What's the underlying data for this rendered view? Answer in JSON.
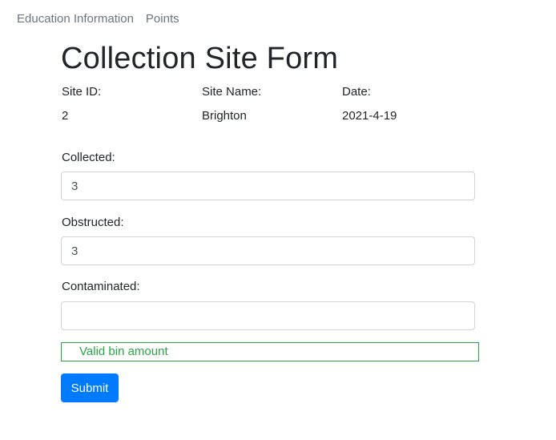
{
  "nav": {
    "items": [
      "Education Information",
      "Points"
    ]
  },
  "form": {
    "title": "Collection Site Form",
    "info": {
      "site_id_label": "Site ID:",
      "site_id_value": "2",
      "site_name_label": "Site Name:",
      "site_name_value": "Brighton",
      "date_label": "Date:",
      "date_value": "2021-4-19"
    },
    "fields": {
      "collected_label": "Collected:",
      "collected_value": "3",
      "obstructed_label": "Obstructed:",
      "obstructed_value": "3",
      "contaminated_label": "Contaminated:",
      "contaminated_value": ""
    },
    "validation_message": "Valid bin amount",
    "submit_label": "Submit"
  },
  "colors": {
    "primary": "#007bff",
    "success": "#28a745",
    "muted": "#6c757d"
  }
}
